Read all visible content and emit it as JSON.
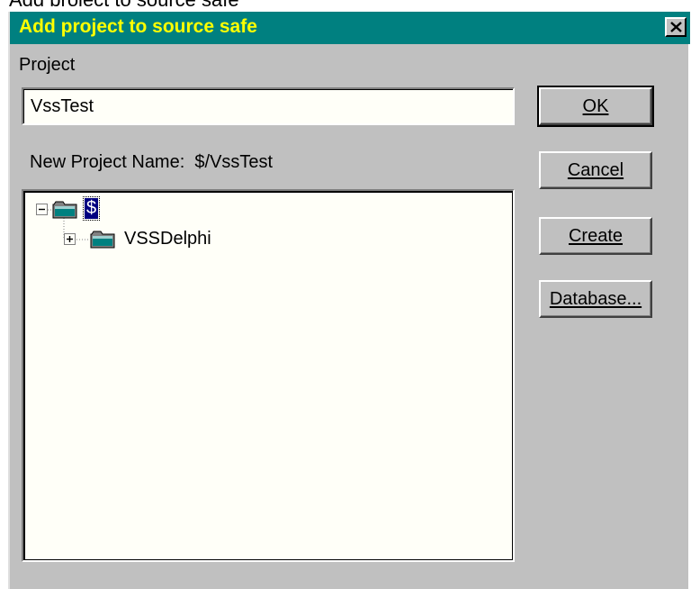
{
  "window": {
    "title": "Add project to source safe",
    "close_label": "×"
  },
  "form": {
    "project_label": "Project",
    "project_value": "VssTest",
    "new_project_label": "New Project Name:",
    "new_project_value": "$/VssTest"
  },
  "tree": {
    "root": {
      "label": "$",
      "expanded": true,
      "selected": true
    },
    "children": [
      {
        "label": "VSSDelphi",
        "expanded": false
      }
    ]
  },
  "buttons": {
    "ok": "OK",
    "cancel": "Cancel",
    "create": "Create",
    "database": "Database..."
  },
  "colors": {
    "titlebar": "#008080",
    "title_text": "#ffff00",
    "dialog_bg": "#c0c0c0",
    "field_bg": "#fffff8",
    "selection": "#000080"
  },
  "icons": [
    "close-icon",
    "folder-icon",
    "expand-minus-icon",
    "expand-plus-icon"
  ]
}
